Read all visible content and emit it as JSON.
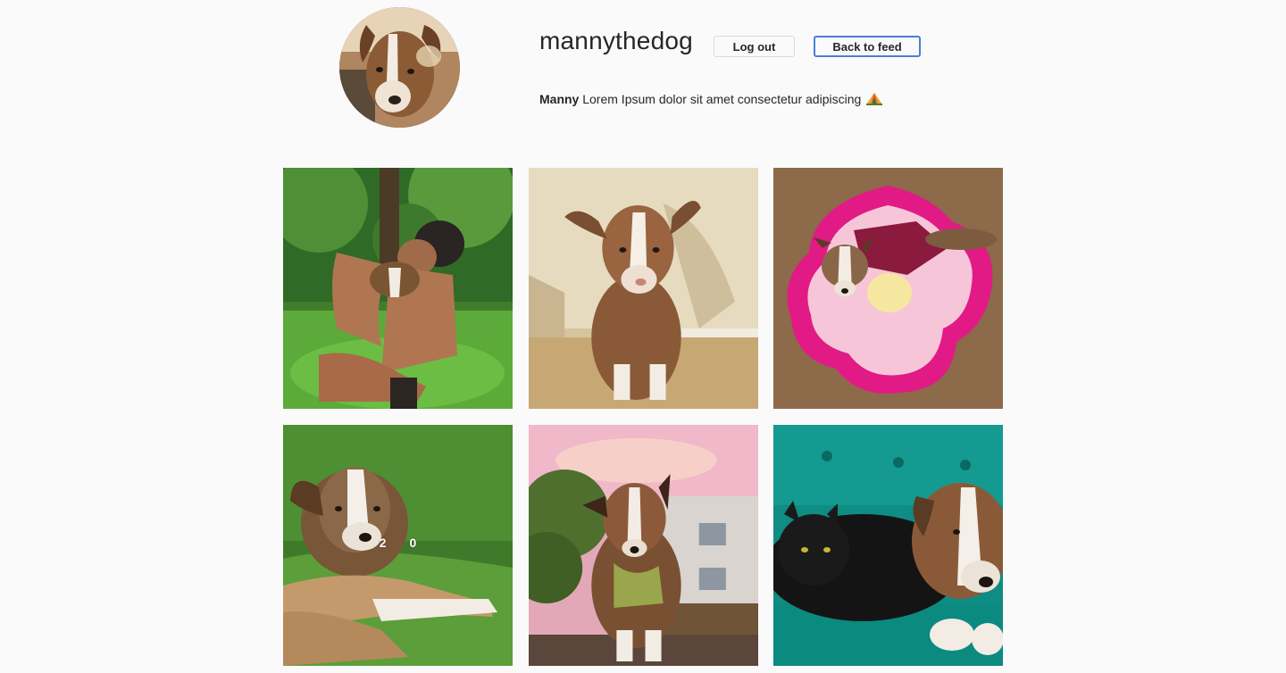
{
  "profile": {
    "username": "mannythedog",
    "logout_label": "Log out",
    "back_label": "Back to feed",
    "bio_name": "Manny",
    "bio_text": " Lorem Ipsum dolor sit amet consectetur adipiscing",
    "bio_emoji": "tent-emoji"
  },
  "posts": [
    {
      "likes": "",
      "comments": ""
    },
    {
      "likes": "",
      "comments": ""
    },
    {
      "likes": "",
      "comments": ""
    },
    {
      "likes": "2",
      "comments": "0"
    },
    {
      "likes": "",
      "comments": ""
    },
    {
      "likes": "",
      "comments": ""
    }
  ],
  "colors": {
    "background": "#fafafa",
    "text": "#262626",
    "button_border": "#dbdbdb",
    "focus_border": "#4a7fd6"
  }
}
